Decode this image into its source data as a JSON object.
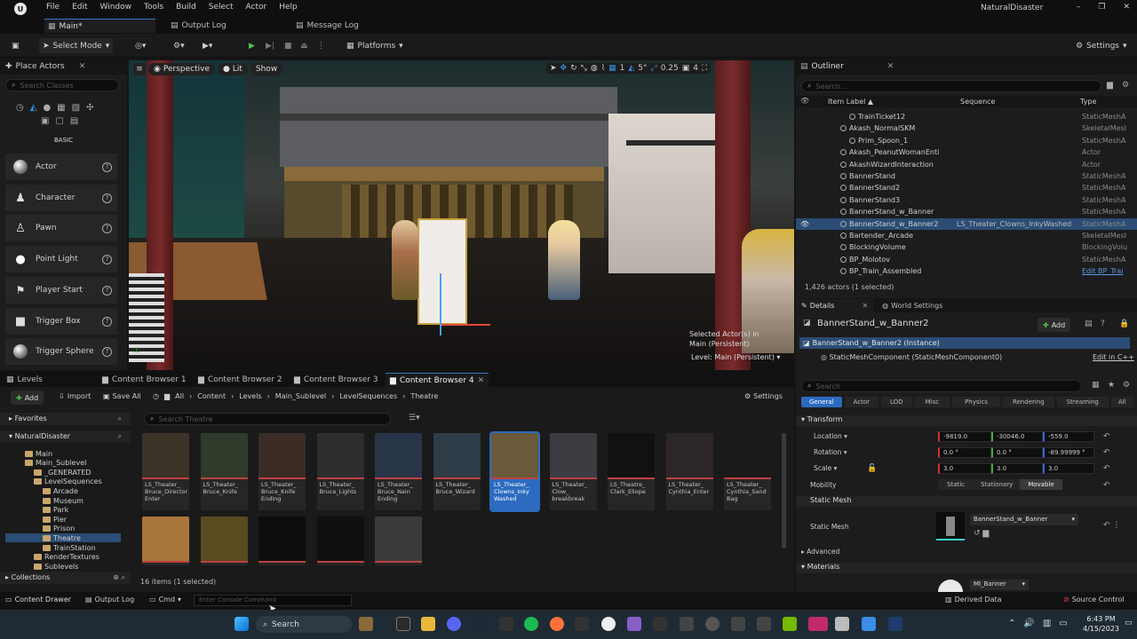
{
  "menubar": {
    "items": [
      "File",
      "Edit",
      "Window",
      "Tools",
      "Build",
      "Select",
      "Actor",
      "Help"
    ],
    "project": "NaturalDisaster"
  },
  "doc_tabs": [
    "Main*",
    "Output Log",
    "Message Log"
  ],
  "toolbar": {
    "select_mode": "Select Mode",
    "platforms": "Platforms",
    "settings": "Settings"
  },
  "place_actors": {
    "title": "Place Actors",
    "search_placeholder": "Search Classes",
    "category": "BASIC",
    "items": [
      "Actor",
      "Character",
      "Pawn",
      "Point Light",
      "Player Start",
      "Trigger Box",
      "Trigger Sphere"
    ]
  },
  "viewport": {
    "perspective": "Perspective",
    "lit": "Lit",
    "show": "Show",
    "grid": "1",
    "rotation": "5°",
    "scale": "0.25",
    "camera": "4",
    "selected_line1": "Selected Actor(s) in",
    "selected_line2": "Main (Persistent)",
    "level": "Level: Main (Persistent)"
  },
  "outliner": {
    "title": "Outliner",
    "search_placeholder": "Search...",
    "columns": [
      "Item Label ▲",
      "Sequence",
      "Type"
    ],
    "rows": [
      {
        "name": "TrainTicket12",
        "type": "StaticMeshA",
        "indent": 3
      },
      {
        "name": "Akash_NormalSKM",
        "type": "SkeletalMesl",
        "indent": 2
      },
      {
        "name": "Prim_Spoon_1",
        "type": "StaticMeshA",
        "indent": 3
      },
      {
        "name": "Akash_PeanutWomanEnti",
        "type": "Actor",
        "indent": 2
      },
      {
        "name": "AkashWizardInteraction",
        "type": "Actor",
        "indent": 2
      },
      {
        "name": "BannerStand",
        "type": "StaticMeshA",
        "indent": 2
      },
      {
        "name": "BannerStand2",
        "type": "StaticMeshA",
        "indent": 2
      },
      {
        "name": "BannerStand3",
        "type": "StaticMeshA",
        "indent": 2
      },
      {
        "name": "BannerStand_w_Banner",
        "type": "StaticMeshA",
        "indent": 2
      },
      {
        "name": "BannerStand_w_Banner2",
        "sequence": "LS_Theater_Clowns_InkyWashed",
        "type": "StaticMeshA",
        "indent": 2,
        "selected": true
      },
      {
        "name": "Bartender_Arcade",
        "type": "SkeletalMesl",
        "indent": 2
      },
      {
        "name": "BlockingVolume",
        "type": "BlockingVolu",
        "indent": 2
      },
      {
        "name": "BP_Molotov",
        "type": "StaticMeshA",
        "indent": 2
      },
      {
        "name": "BP_Train_Assembled",
        "type": "Edit BP_Trai",
        "indent": 2
      }
    ],
    "count": "1,426 actors (1 selected)"
  },
  "details": {
    "tab1": "Details",
    "tab2": "World Settings",
    "actor": "BannerStand_w_Banner2",
    "add": "Add",
    "instance": "BannerStand_w_Banner2 (Instance)",
    "component": "StaticMeshComponent (StaticMeshComponent0)",
    "edit_cpp": "Edit in C++",
    "search_placeholder": "Search",
    "filters": [
      "General",
      "Actor",
      "LOD",
      "Misc",
      "Physics",
      "Rendering",
      "Streaming",
      "All"
    ],
    "transform": "Transform",
    "location": "Location",
    "rotation": "Rotation",
    "scale": "Scale",
    "loc": [
      "-9819.0",
      "-30046.0",
      "-559.0"
    ],
    "rot": [
      "0.0 °",
      "0.0 °",
      "-89.99999 °"
    ],
    "scl": [
      "3.0",
      "3.0",
      "3.0"
    ],
    "mobility": "Mobility",
    "mob_opts": [
      "Static",
      "Stationary",
      "Movable"
    ],
    "static_mesh_hdr": "Static Mesh",
    "static_mesh_lbl": "Static Mesh",
    "mesh_value": "BannerStand_w_Banner",
    "advanced": "Advanced",
    "materials": "Materials",
    "material_value": "MI_Banner"
  },
  "content": {
    "tabs": [
      "Levels",
      "Content Browser 1",
      "Content Browser 2",
      "Content Browser 3",
      "Content Browser 4"
    ],
    "add": "Add",
    "import": "Import",
    "save_all": "Save All",
    "path": [
      "All",
      "Content",
      "Levels",
      "Main_Sublevel",
      "LevelSequences",
      "Theatre"
    ],
    "settings": "Settings",
    "favorites": "Favorites",
    "root": "NaturalDisaster",
    "search_placeholder": "Search Theatre",
    "tree": [
      {
        "label": "Main",
        "lvl": 3
      },
      {
        "label": "Main_Sublevel",
        "lvl": 3
      },
      {
        "label": "_GENERATED",
        "lvl": 4
      },
      {
        "label": "LevelSequences",
        "lvl": 4
      },
      {
        "label": "Arcade",
        "lvl": 5
      },
      {
        "label": "Museum",
        "lvl": 5
      },
      {
        "label": "Park",
        "lvl": 5
      },
      {
        "label": "Pier",
        "lvl": 5
      },
      {
        "label": "Prison",
        "lvl": 5
      },
      {
        "label": "Theatre",
        "lvl": 5,
        "selected": true
      },
      {
        "label": "TrainStation",
        "lvl": 5
      },
      {
        "label": "RenderTextures",
        "lvl": 4
      },
      {
        "label": "Sublevels",
        "lvl": 4
      }
    ],
    "assets": [
      {
        "label": "LS_Theater_ Bruce_Director Enter"
      },
      {
        "label": "LS_Theater_ Bruce_Knife"
      },
      {
        "label": "LS_Theater_ Bruce_Knife Ending"
      },
      {
        "label": "LS_Theater_ Bruce_Lights"
      },
      {
        "label": "LS_Theater_ Bruce_Nain Ending"
      },
      {
        "label": "LS_Theater_ Bruce_Wizard"
      },
      {
        "label": "LS_Theater_ Clowns_Inky Washed",
        "selected": true
      },
      {
        "label": "LS_Theater_ Clow_ breakbreak"
      },
      {
        "label": "LS_Theatre_ Clark_Eliope"
      },
      {
        "label": "LS_Theater_ Cynthia_Enter"
      },
      {
        "label": "LS_Theater_ Cynthia_Sand Bag"
      }
    ],
    "collections": "Collections",
    "count": "16 items (1 selected)"
  },
  "status": {
    "drawer": "Content Drawer",
    "output": "Output Log",
    "cmd": "Cmd",
    "console": "Enter Console Command",
    "derived": "Derived Data",
    "source": "Source Control"
  },
  "taskbar": {
    "search": "Search",
    "time": "6:43 PM",
    "date": "4/15/2023"
  }
}
